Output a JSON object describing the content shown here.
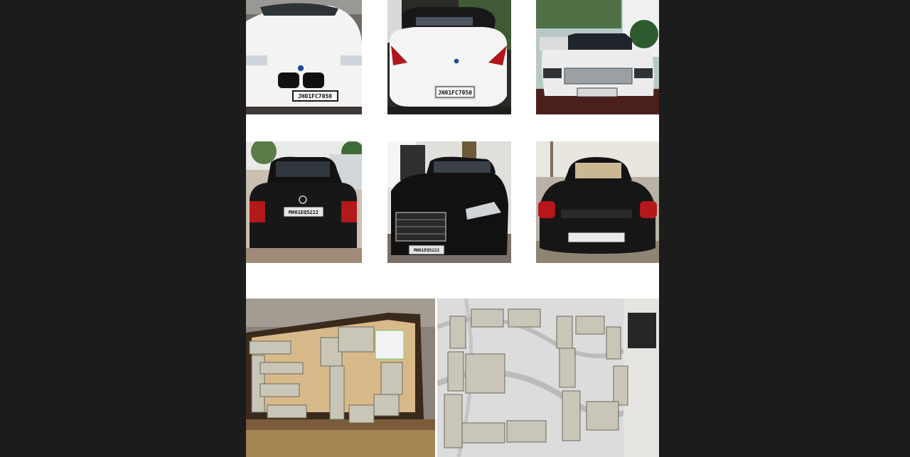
{
  "image": {
    "description_items": [
      {
        "id": "white-bmw-sedan",
        "plate": "JH01FC7050"
      },
      {
        "id": "white-bmw-convertible",
        "plate": "JH01FC7050"
      },
      {
        "id": "white-range-rover",
        "plate": ""
      },
      {
        "id": "black-mercedes-rear",
        "plate": "MH01EQ5222"
      },
      {
        "id": "black-mercedes-front",
        "plate": "MH01EQ5222"
      },
      {
        "id": "black-porsche-cayman",
        "plate": ""
      }
    ]
  },
  "colors": {
    "background": "#1c1c1c",
    "panel": "#ffffff",
    "white_car": "#f2f2f2",
    "black_car": "#161616",
    "cash": "#c9c6b8",
    "marble": "#dcdcdc",
    "box_lid": "#d8b98a"
  },
  "icons": [
    "money-bundle-icon"
  ]
}
